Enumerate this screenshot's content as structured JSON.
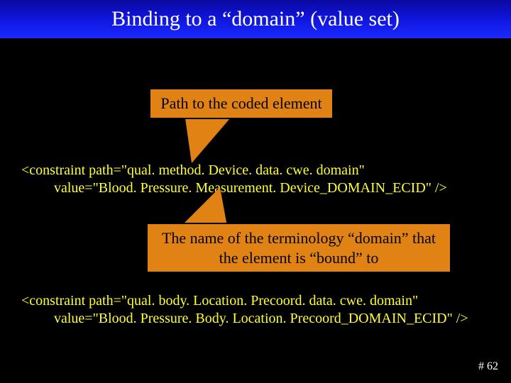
{
  "header": {
    "title": "Binding to a “domain” (value set)"
  },
  "callouts": {
    "top": "Path to the coded element",
    "bottom": "The name of the terminology “domain” that the element is “bound” to"
  },
  "code": {
    "block1": {
      "line1": "<constraint path=\"qual. method. Device. data. cwe. domain\"",
      "line2": "value=\"Blood. Pressure. Measurement. Device_DOMAIN_ECID\" />"
    },
    "block2": {
      "line1": "<constraint path=\"qual. body. Location. Precoord. data. cwe. domain\"",
      "line2": "value=\"Blood. Pressure. Body. Location. Precoord_DOMAIN_ECID\" />"
    }
  },
  "footer": {
    "slide_number": "# 62"
  }
}
